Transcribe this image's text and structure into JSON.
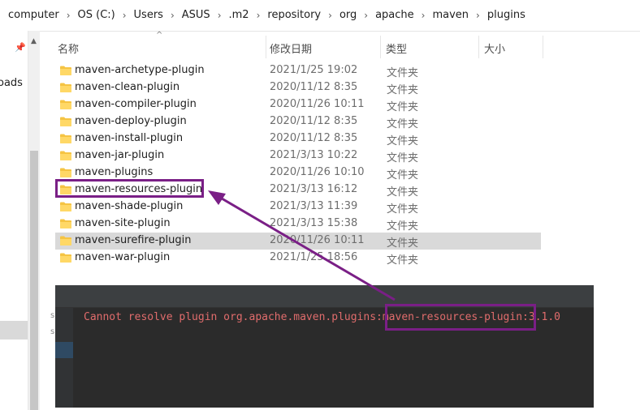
{
  "breadcrumb": [
    "computer",
    "OS (C:)",
    "Users",
    "ASUS",
    ".m2",
    "repository",
    "org",
    "apache",
    "maven",
    "plugins"
  ],
  "nav": {
    "label": "oads"
  },
  "columns": {
    "name": "名称",
    "date": "修改日期",
    "type": "类型",
    "size": "大小"
  },
  "rows": [
    {
      "name": "maven-archetype-plugin",
      "date": "2021/1/25 19:02",
      "type": "文件夹"
    },
    {
      "name": "maven-clean-plugin",
      "date": "2020/11/12 8:35",
      "type": "文件夹"
    },
    {
      "name": "maven-compiler-plugin",
      "date": "2020/11/26 10:11",
      "type": "文件夹"
    },
    {
      "name": "maven-deploy-plugin",
      "date": "2020/11/12 8:35",
      "type": "文件夹"
    },
    {
      "name": "maven-install-plugin",
      "date": "2020/11/12 8:35",
      "type": "文件夹"
    },
    {
      "name": "maven-jar-plugin",
      "date": "2021/3/13 10:22",
      "type": "文件夹"
    },
    {
      "name": "maven-plugins",
      "date": "2020/11/26 10:10",
      "type": "文件夹"
    },
    {
      "name": "maven-resources-plugin",
      "date": "2021/3/13 16:12",
      "type": "文件夹"
    },
    {
      "name": "maven-shade-plugin",
      "date": "2021/3/13 11:39",
      "type": "文件夹"
    },
    {
      "name": "maven-site-plugin",
      "date": "2021/3/13 15:38",
      "type": "文件夹"
    },
    {
      "name": "maven-surefire-plugin",
      "date": "2020/11/26 10:11",
      "type": "文件夹"
    },
    {
      "name": "maven-war-plugin",
      "date": "2021/1/25 18:56",
      "type": "文件夹"
    }
  ],
  "terminal": {
    "message": "Cannot resolve plugin org.apache.maven.plugins:maven-resources-plugin:3.1.0",
    "highlight": "maven-resources-plugin"
  },
  "colors": {
    "annotation": "#7a1f86",
    "error_text": "#e06c6c",
    "folder": "#f5c443"
  },
  "icons": {
    "folder": "folder-icon",
    "pin": "pin-icon",
    "arrow": "arrow-annotation"
  }
}
